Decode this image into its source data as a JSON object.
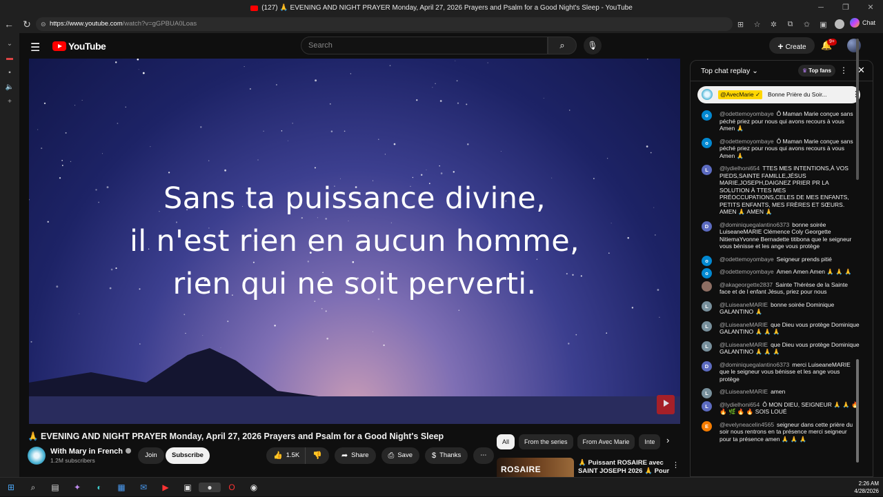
{
  "window": {
    "title": "(127) 🙏 EVENING AND NIGHT PRAYER Monday, April 27, 2026 Prayers and Psalm for a Good Night's Sleep - YouTube",
    "url_host": "https://www.youtube.com",
    "url_path": "/watch?v=gGPBUA0Loas",
    "chat_label": "Chat"
  },
  "masthead": {
    "logo": "YouTube",
    "search_placeholder": "Search",
    "create_label": "Create",
    "notification_count": "9+"
  },
  "video": {
    "lyrics": [
      "Sans ta puissance divine,",
      "il n'est rien en aucun homme,",
      "rien qui ne soit perverti."
    ],
    "title": "🙏 EVENING AND NIGHT PRAYER Monday, April 27, 2026 Prayers and Psalm for a Good Night's Sleep",
    "channel": "With Mary in French",
    "subscribers": "1.2M subscribers",
    "join_label": "Join",
    "subscribe_label": "Subscribe",
    "likes": "1.5K",
    "share_label": "Share",
    "save_label": "Save",
    "thanks_label": "Thanks"
  },
  "chips": [
    "All",
    "From the series",
    "From Avec Marie",
    "Inte"
  ],
  "recommendation": {
    "thumb_text": "ROSAIRE",
    "title": "🙏 Puissant ROSAIRE avec SAINT JOSEPH 2026 🙏 Pour ..."
  },
  "chat": {
    "title": "Top chat replay",
    "top_fans_label": "Top fans",
    "pinned_author": "@AvecMarie ✓",
    "pinned_message": "Bonne Prière du Soir...",
    "messages": [
      {
        "initial": "o",
        "color": "#0288d1",
        "author": "@odettemoyombaye",
        "text": "Ô Maman Marie conçue sans péché priez pour nous qui avons recours à vous Amen 🙏"
      },
      {
        "initial": "o",
        "color": "#0288d1",
        "author": "@odettemoyombaye",
        "text": "Ô Maman Marie conçue sans péché priez pour nous qui avons recours à vous Amen 🙏"
      },
      {
        "initial": "L",
        "color": "#5c6bc0",
        "author": "@lydielhoni654",
        "text": "TTES MES INTENTIONS,À VOS PIEDS,SAINTE FAMILLE,JÉSUS MARIE,JOSEPH,DAIGNEZ PRIER PR LA SOLUTION À TTES MES PRÉOCCUPATIONS,CELES DE MES ENFANTS, PETITS ENFANTS, MES FRÈRES ET SŒURS. AMEN 🙏 AMEN 🙏"
      },
      {
        "initial": "D",
        "color": "#5c6bc0",
        "author": "@dominiquegalantino6373",
        "text": "bonne soirée LuiseaneMARIE Clémence Coly Georgette NitiemaYvonne Bernadette titibona que le seigneur vous bénisse et les ange vous protège"
      },
      {
        "initial": "o",
        "color": "#0288d1",
        "author": "@odettemoyombaye",
        "text": "Seigneur prends pitié"
      },
      {
        "initial": "o",
        "color": "#0288d1",
        "author": "@odettemoyombaye",
        "text": "Amen Amen Amen 🙏 🙏 🙏"
      },
      {
        "initial": "",
        "color": "#8d6e63",
        "author": "@akageorgette2837",
        "text": "Sainte Thérèse de la Sainte face et de l enfant Jésus, priez pour nous"
      },
      {
        "initial": "L",
        "color": "#78909c",
        "author": "@LuiseaneMARIE",
        "text": "bonne soirée Dominique GALANTINO 🙏"
      },
      {
        "initial": "L",
        "color": "#78909c",
        "author": "@LuiseaneMARIE",
        "text": "que Dieu vous protège Dominique GALANTINO 🙏 🙏 🙏"
      },
      {
        "initial": "L",
        "color": "#78909c",
        "author": "@LuiseaneMARIE",
        "text": "que Dieu vous protège Dominique GALANTINO 🙏 🙏 🙏"
      },
      {
        "initial": "D",
        "color": "#5c6bc0",
        "author": "@dominiquegalantino6373",
        "text": "merci LuiseaneMARIE que le seigneur vous bénisse et les ange vous protège"
      },
      {
        "initial": "L",
        "color": "#78909c",
        "author": "@LuiseaneMARIE",
        "text": "amen"
      },
      {
        "initial": "L",
        "color": "#5c6bc0",
        "author": "@lydielhoni654",
        "text": "Ô MON DIEU, SEIGNEUR 🙏 🙏 🔥 🔥 🌿 🔥 🔥 SOIS LOUÉ"
      },
      {
        "initial": "E",
        "color": "#f57c00",
        "author": "@evelyneacelin4565",
        "text": "seigneur dans cette prière du soir nous rentrons en ta présence merci seigneur pour ta présence amen 🙏 🙏 🙏"
      }
    ]
  },
  "taskbar": {
    "time": "2:26 AM",
    "date": "4/28/2026"
  }
}
